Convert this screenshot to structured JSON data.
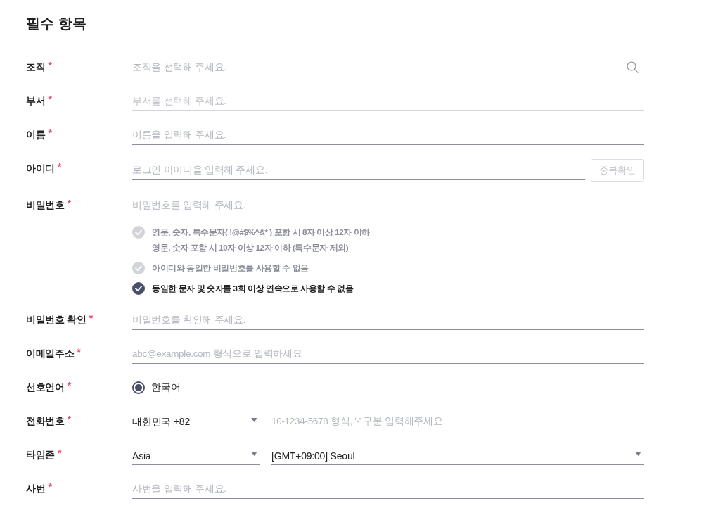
{
  "title": "필수 항목",
  "fields": [
    {
      "kind": "search",
      "label": "조직",
      "required_mark": "*",
      "placeholder": "조직을 선택해 주세요.",
      "disabled": false
    },
    {
      "kind": "text",
      "label": "부서",
      "required_mark": "*",
      "placeholder": "부서를 선택해 주세요.",
      "disabled": true
    },
    {
      "kind": "text",
      "label": "이름",
      "required_mark": "*",
      "placeholder": "이름을 입력해 주세요.",
      "disabled": false
    },
    {
      "kind": "text_button",
      "label": "아이디",
      "required_mark": "*",
      "placeholder": "로그인 아이디을 입력해 주세요.",
      "disabled": false,
      "button": {
        "label": "중복확인",
        "disabled": true
      }
    },
    {
      "kind": "password",
      "label": "비밀번호",
      "required_mark": "*",
      "placeholder": "비밀번호를 입력해 주세요.",
      "disabled": false,
      "rules": [
        {
          "lines": [
            "영문, 숫자, 특수문자( !@#$%^&* ) 포함 시 8자 이상 12자 이하",
            "영문, 숫자 포함 시 10자 이상 12자 이하 (특수문자 제외)"
          ],
          "checked": false
        },
        {
          "lines": [
            "아이디와 동일한 비밀번호를 사용할 수 없음"
          ],
          "checked": false
        },
        {
          "lines": [
            "동일한 문자 및 숫자를 3회 이상 연속으로 사용할 수 없음"
          ],
          "checked": true
        }
      ]
    },
    {
      "kind": "text",
      "label": "비밀번호 확인",
      "required_mark": "*",
      "placeholder": "비밀번호를 확인해 주세요.",
      "disabled": false
    },
    {
      "kind": "text",
      "label": "이메일주소",
      "required_mark": "*",
      "placeholder": "abc@example.com 형식으로 입력하세요",
      "disabled": false
    },
    {
      "kind": "radio",
      "label": "선호언어",
      "required_mark": "*",
      "disabled": false,
      "options": [
        {
          "label": "한국어",
          "selected": true
        }
      ]
    },
    {
      "kind": "pair",
      "label": "전화번호",
      "required_mark": "*",
      "disabled": false,
      "parts": [
        {
          "kind": "select",
          "value": "대한민국 +82"
        },
        {
          "kind": "input",
          "placeholder": "10-1234-5678 형식, '-' 구분 입력해주세요"
        }
      ]
    },
    {
      "kind": "pair",
      "label": "타임존",
      "required_mark": "*",
      "disabled": false,
      "parts": [
        {
          "kind": "select",
          "value": "Asia"
        },
        {
          "kind": "select",
          "value": "[GMT+09:00] Seoul"
        }
      ]
    },
    {
      "kind": "text",
      "label": "사번",
      "required_mark": "*",
      "placeholder": "사번을 입력해 주세요.",
      "disabled": false
    }
  ]
}
